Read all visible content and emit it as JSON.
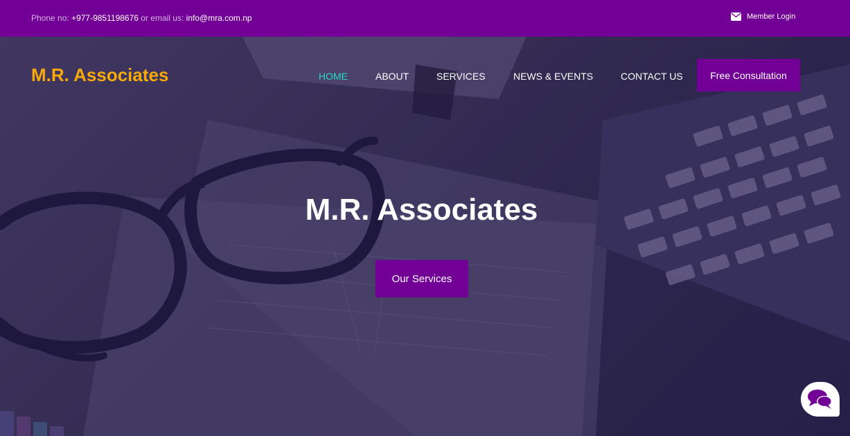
{
  "topbar": {
    "phone_label": "Phone no:",
    "phone_value": "+977-9851198676",
    "or_text": "or",
    "email_label": "email us:",
    "email_value": "info@mra.com.np",
    "member_login": "Member Login",
    "member_icon": "envelope-icon"
  },
  "header": {
    "brand": "M.R. Associates",
    "nav": {
      "home": "HOME",
      "about": "ABOUT",
      "services": "SERVICES",
      "news": "NEWS & EVENTS",
      "contact": "CONTACT US"
    },
    "cta": "Free Consultation"
  },
  "hero": {
    "title": "M.R. Associates",
    "button": "Our Services"
  },
  "chat": {
    "icon": "chat-bubbles-icon"
  },
  "colors": {
    "brand_purple": "#730096",
    "logo_orange": "#f5a90a",
    "active_nav": "#27d8c7"
  }
}
